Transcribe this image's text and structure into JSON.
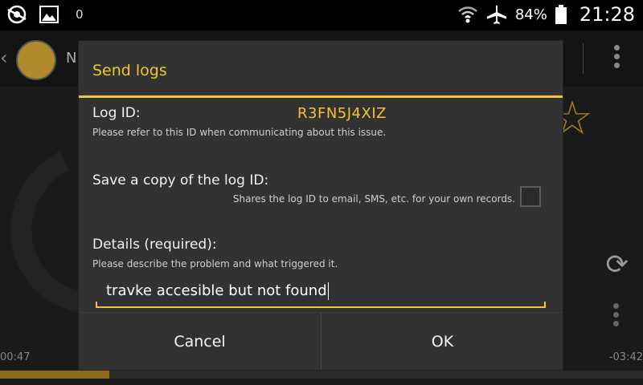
{
  "status_bar": {
    "notification_count": "0",
    "battery_percent": "84%",
    "time": "21:28",
    "icons": [
      "app-notification-icon",
      "gallery-icon",
      "wifi-icon",
      "airplane-mode-icon",
      "battery-icon"
    ]
  },
  "background_app": {
    "elapsed": "00:47",
    "remaining": "-03:42",
    "progress": 0.17,
    "accent_color": "#8a6a18",
    "title_fragment": "N"
  },
  "dialog": {
    "title": "Send logs",
    "accent_color": "#f2c335",
    "log_id_label": "Log ID:",
    "log_id_value": "R3FN5J4XIZ",
    "log_id_hint": "Please refer to this ID when communicating about this issue.",
    "save_copy_label": "Save a copy of the log ID:",
    "save_copy_hint": "Shares the log ID to email, SMS, etc. for your own records.",
    "save_copy_checked": false,
    "details_label": "Details (required):",
    "details_hint": "Please describe the problem and what triggered it.",
    "details_value": "travke accesible but not found",
    "cancel_label": "Cancel",
    "ok_label": "OK"
  }
}
